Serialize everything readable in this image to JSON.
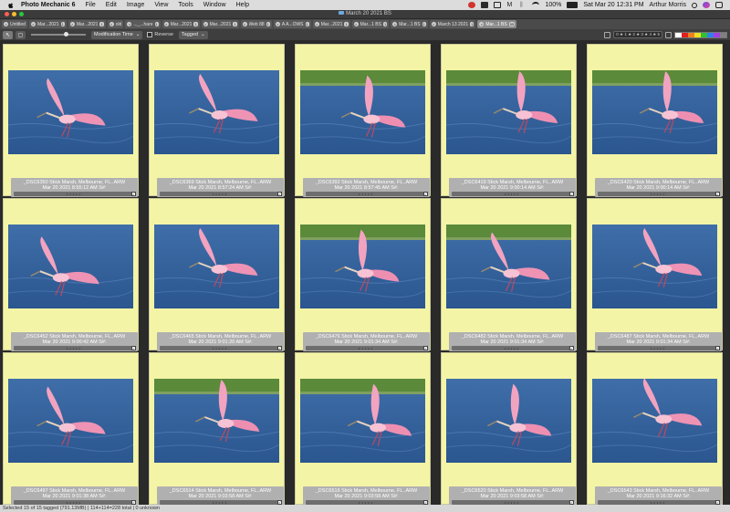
{
  "menubar": {
    "app_name": "Photo Mechanic 6",
    "items": [
      "File",
      "Edit",
      "Image",
      "View",
      "Tools",
      "Window",
      "Help"
    ],
    "battery": "100%",
    "datetime": "Sat Mar 20  12:31 PM",
    "user": "Arthur Morris"
  },
  "window": {
    "title": "March 20 2021 BS"
  },
  "tabs": [
    {
      "label": "Untitled",
      "count": "",
      "active": false
    },
    {
      "label": "Mar...2021",
      "count": "1",
      "active": false
    },
    {
      "label": "Mar...2021",
      "count": "1",
      "active": false
    },
    {
      "label": "old",
      "count": "",
      "active": false
    },
    {
      "label": "..._...hare",
      "count": "1",
      "active": false
    },
    {
      "label": "Mar...2021",
      "count": "1",
      "active": false
    },
    {
      "label": "Mar...2021",
      "count": "1",
      "active": false
    },
    {
      "label": "Web 88",
      "count": "1",
      "active": false
    },
    {
      "label": "A A...OWS",
      "count": "1",
      "active": false
    },
    {
      "label": "Mar...2021",
      "count": "1",
      "active": false
    },
    {
      "label": "Mar...1 BS",
      "count": "1",
      "active": false
    },
    {
      "label": "Mar...1 BS",
      "count": "1",
      "active": false
    },
    {
      "label": "March 13 2021",
      "count": "1",
      "active": false
    },
    {
      "label": "Mar...1 BS",
      "count": "55",
      "active": true
    }
  ],
  "toolbar": {
    "sort_label": "Modification Time",
    "reverse_label": "Reverse",
    "filter_label": "Tagged",
    "star_filter": "0 ★ 1 ★ 2 ★ 3 ★ 4 ★ 5",
    "slider_level": 0.6,
    "color_swatches": [
      "#ffffff",
      "#e02020",
      "#f08020",
      "#f0e020",
      "#30c030",
      "#3080f0",
      "#a040e0",
      "#808080"
    ]
  },
  "photos": [
    {
      "filename": "_DSC6350 Stick Marsh, Melbourne, FL..ARW",
      "date": "Mar 20 2021 8:55:12 AM S#:"
    },
    {
      "filename": "_DSC6369 Stick Marsh, Melbourne, FL..ARW",
      "date": "Mar 20 2021 8:57:24 AM S#:"
    },
    {
      "filename": "_DSC6392 Stick Marsh, Melbourne, FL..ARW",
      "date": "Mar 20 2021 8:57:45 AM S#:"
    },
    {
      "filename": "_DSC6419 Stick Marsh, Melbourne, FL..ARW",
      "date": "Mar 20 2021 9:00:14 AM S#:"
    },
    {
      "filename": "_DSC6420 Stick Marsh, Melbourne, FL..ARW",
      "date": "Mar 20 2021 9:00:14 AM S#:"
    },
    {
      "filename": "_DSC6452 Stick Marsh, Melbourne, FL..ARW",
      "date": "Mar 20 2021 9:00:42 AM S#:"
    },
    {
      "filename": "_DSC6465 Stick Marsh, Melbourne, FL..ARW",
      "date": "Mar 20 2021 9:01:20 AM S#:"
    },
    {
      "filename": "_DSC6476 Stick Marsh, Melbourne, FL..ARW",
      "date": "Mar 20 2021 9:01:34 AM S#:"
    },
    {
      "filename": "_DSC6482 Stick Marsh, Melbourne, FL..ARW",
      "date": "Mar 20 2021 9:01:34 AM S#:"
    },
    {
      "filename": "_DSC6487 Stick Marsh, Melbourne, FL..ARW",
      "date": "Mar 20 2021 9:01:34 AM S#:"
    },
    {
      "filename": "_DSC6497 Stick Marsh, Melbourne, FL..ARW",
      "date": "Mar 20 2021 9:01:38 AM S#:"
    },
    {
      "filename": "_DSC6514 Stick Marsh, Melbourne, FL..ARW",
      "date": "Mar 20 2021 9:03:58 AM S#:"
    },
    {
      "filename": "_DSC6516 Stick Marsh, Melbourne, FL..ARW",
      "date": "Mar 20 2021 9:03:58 AM S#:"
    },
    {
      "filename": "_DSC6520 Stick Marsh, Melbourne, FL..ARW",
      "date": "Mar 20 2021 9:03:58 AM S#:"
    },
    {
      "filename": "_DSC6543 Stick Marsh, Melbourne, FL..ARW",
      "date": "Mar 20 2021 9:16:32 AM S#:"
    }
  ],
  "statusbar": {
    "text": "Selected 15 of 15 tagged (791.13MB) | 114+114=228 total | 0 unknown"
  }
}
